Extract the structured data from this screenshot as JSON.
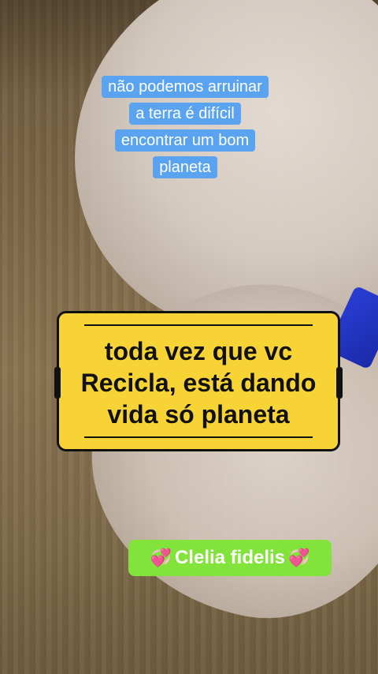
{
  "caption_top": "não podemos arruinar a terra é difícil encontrar um bom planeta",
  "caption_top_lines": [
    "não podemos arruinar",
    "a terra é difícil",
    "encontrar um bom",
    "planeta"
  ],
  "main_caption_lines": [
    "toda vez que vc",
    "Recicla, está dando",
    "vida só planeta"
  ],
  "credit": {
    "name": "Clelia fidelis",
    "emoji": "💞"
  },
  "colors": {
    "caption_bg": "#5aa3f0",
    "main_bg": "#f7d336",
    "credit_bg": "#82e33a"
  }
}
